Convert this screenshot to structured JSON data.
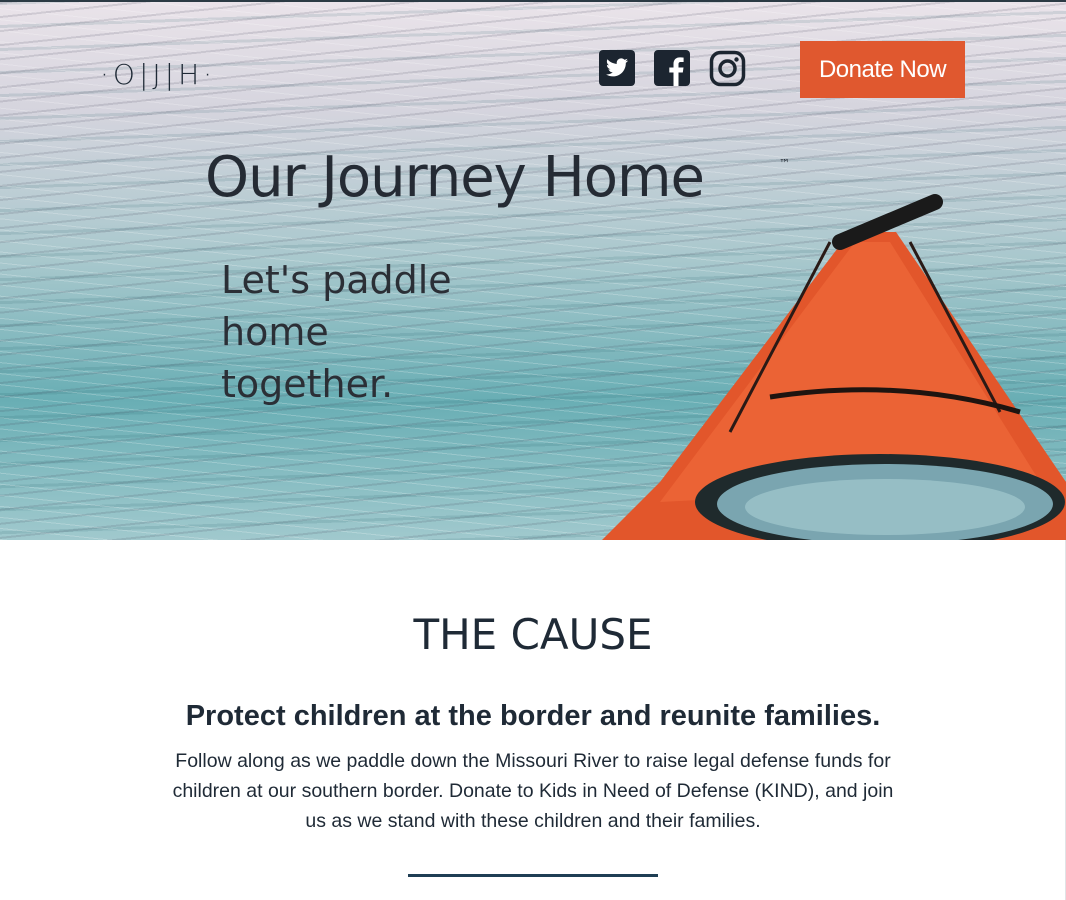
{
  "logo": {
    "text": "·O|J|H·"
  },
  "social": [
    {
      "name": "twitter",
      "icon": "twitter-icon"
    },
    {
      "name": "facebook",
      "icon": "facebook-icon"
    },
    {
      "name": "instagram",
      "icon": "instagram-icon"
    }
  ],
  "header": {
    "donate_label": "Donate Now"
  },
  "hero": {
    "title": "Our Journey Home",
    "trademark": "™",
    "tagline_lines": [
      "Let's paddle",
      "home",
      "together."
    ]
  },
  "cause": {
    "heading": "THE CAUSE",
    "subheading": "Protect children at the border and reunite families.",
    "body": "Follow along as we paddle down the Missouri River to raise legal defense funds for children at our southern border. Donate to Kids in Need of Defense (KIND), and join us as we stand with these children and their families."
  },
  "colors": {
    "accent": "#e0582f",
    "text": "#1f2a36",
    "divider": "#1f3e54",
    "icon": "#1c2530"
  }
}
